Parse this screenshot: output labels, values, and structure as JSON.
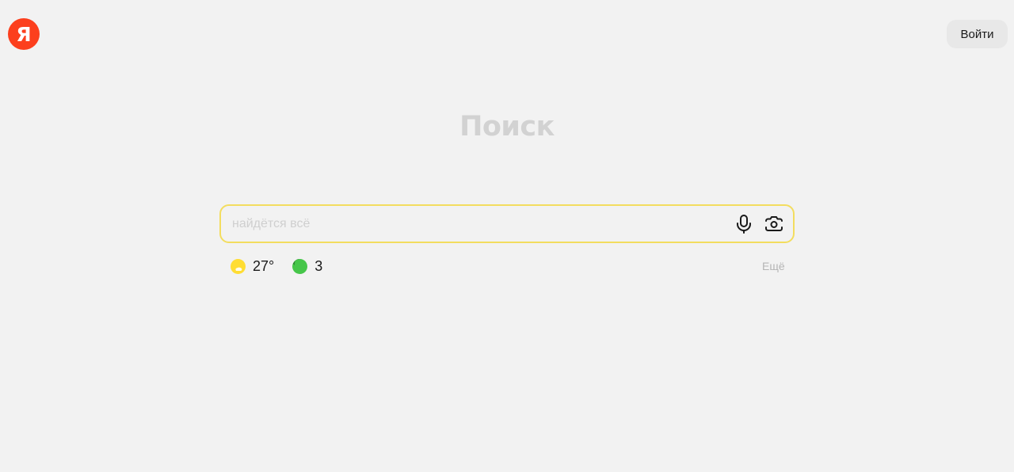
{
  "header": {
    "logo_letter": "Я",
    "login_label": "Войти"
  },
  "main": {
    "title": "Поиск",
    "search": {
      "value": "",
      "placeholder": "найдётся всё"
    },
    "informers": [
      {
        "icon": "weather-sun-icon",
        "text": "27°"
      },
      {
        "icon": "traffic-jams-icon",
        "text": "3"
      }
    ],
    "more_label": "Ещё"
  },
  "colors": {
    "brand": "#fc3f1d",
    "search_border": "#f3dd5f",
    "weather_sun": "#ffdd33",
    "traffic_green": "#46c64a"
  }
}
